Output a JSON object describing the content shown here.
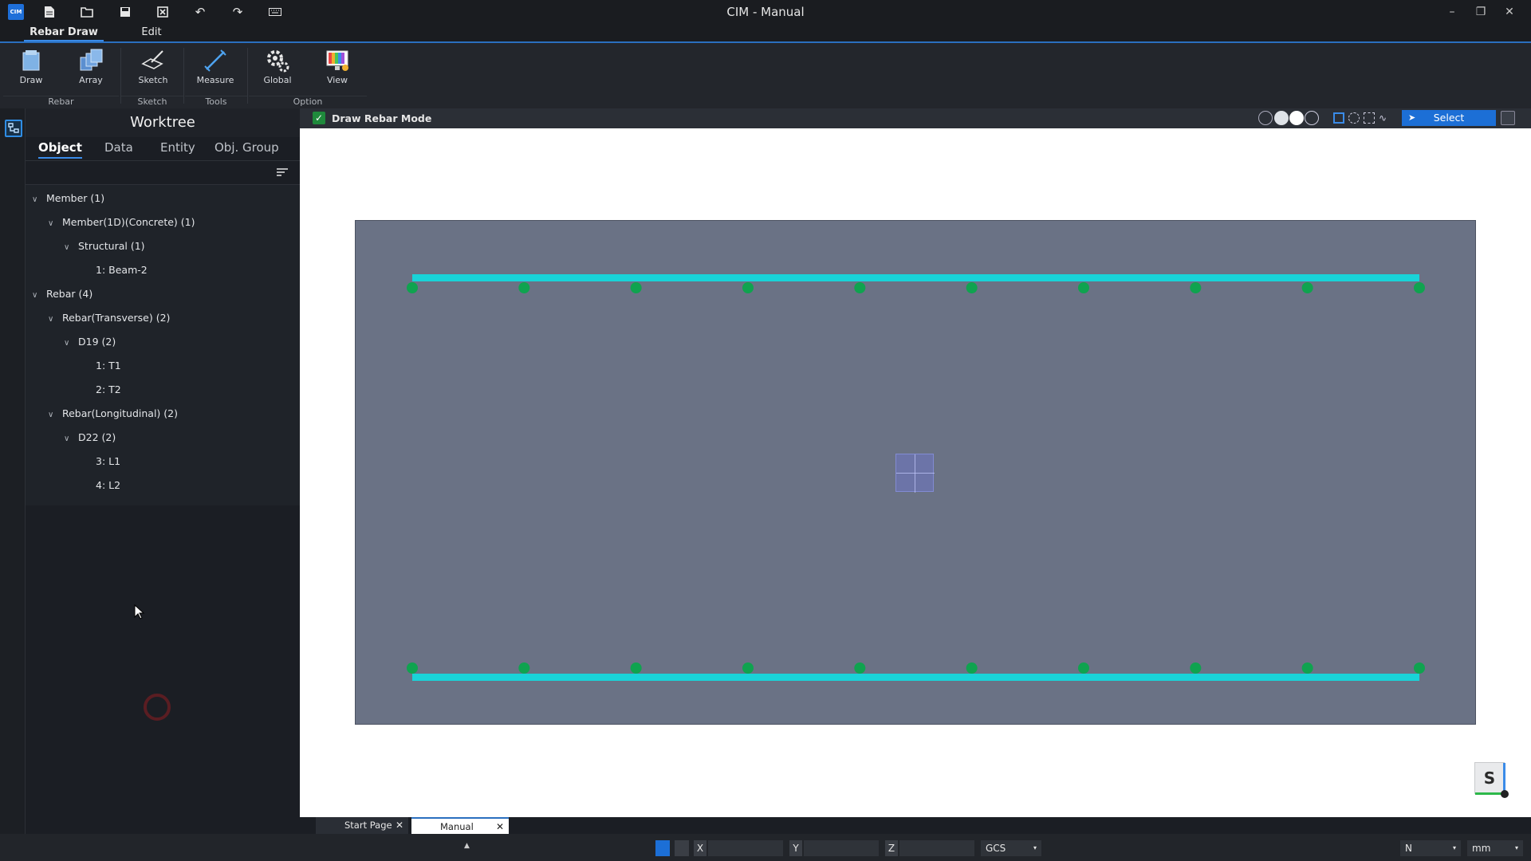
{
  "window": {
    "title": "CIM - Manual",
    "logo_text": "CIM"
  },
  "menu": {
    "tabs": [
      "Rebar Draw",
      "Edit"
    ]
  },
  "ribbon": {
    "buttons": [
      "Draw",
      "Array",
      "Sketch",
      "Measure",
      "Global",
      "View"
    ],
    "groups": [
      "Rebar",
      "Sketch",
      "Tools",
      "Option"
    ]
  },
  "worktree": {
    "title": "Worktree",
    "tabs": [
      "Object",
      "Data",
      "Entity",
      "Obj. Group"
    ],
    "nodes": [
      "Member (1)",
      "Member(1D)(Concrete) (1)",
      "Structural (1)",
      "1: Beam-2",
      "Rebar (4)",
      "Rebar(Transverse) (2)",
      "D19 (2)",
      "1: T1",
      "2: T2",
      "Rebar(Longitudinal) (2)",
      "D22 (2)",
      "3: L1",
      "4: L2"
    ]
  },
  "viewport": {
    "mode_label": "Draw Rebar Mode",
    "select_label": "Select",
    "view_cube_label": "S",
    "rebar_color": "#19d3d8",
    "bar_dot_color": "#0fa34f",
    "bar_count_per_row": 10
  },
  "doc_tabs": [
    "Start Page",
    "Manual"
  ],
  "status": {
    "x_label": "X",
    "y_label": "Y",
    "z_label": "Z",
    "coord_system": "GCS",
    "force_unit": "N",
    "length_unit": "mm"
  }
}
